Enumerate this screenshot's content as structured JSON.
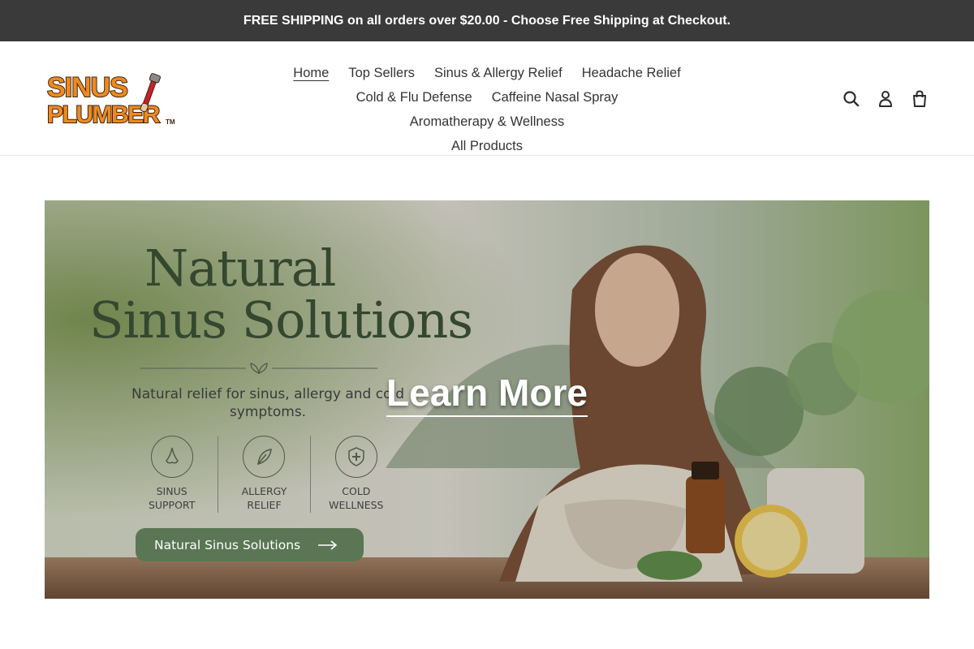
{
  "announcement": "FREE SHIPPING on all orders over $20.00 - Choose Free Shipping at Checkout.",
  "logo": {
    "line1": "SINUS",
    "line2": "PLUMBER",
    "tm": "TM"
  },
  "nav": {
    "items": [
      {
        "label": "Home",
        "active": true
      },
      {
        "label": "Top Sellers"
      },
      {
        "label": "Sinus & Allergy Relief"
      },
      {
        "label": "Headache Relief"
      },
      {
        "label": "Cold & Flu Defense"
      },
      {
        "label": "Caffeine Nasal Spray"
      },
      {
        "label": "Aromatherapy & Wellness"
      },
      {
        "label": "All Products"
      }
    ]
  },
  "header_icons": [
    "search-icon",
    "account-icon",
    "cart-icon"
  ],
  "banner": {
    "title_line1": "Natural",
    "title_line2": "Sinus Solutions",
    "subtitle": "Natural relief for sinus, allergy and cold symptoms.",
    "features": [
      {
        "icon": "nose-icon",
        "label": "Sinus\nSupport"
      },
      {
        "icon": "leaf-icon",
        "label": "Allergy\nRelief"
      },
      {
        "icon": "shield-plus-icon",
        "label": "Cold\nWellness"
      }
    ],
    "pill_label": "Natural Sinus Solutions",
    "cta": "Learn More"
  },
  "colors": {
    "announcement_bg": "#3a3a3a",
    "title_green": "#34472f",
    "pill_green": "#5a7654",
    "logo_orange": "#f08a1e"
  }
}
